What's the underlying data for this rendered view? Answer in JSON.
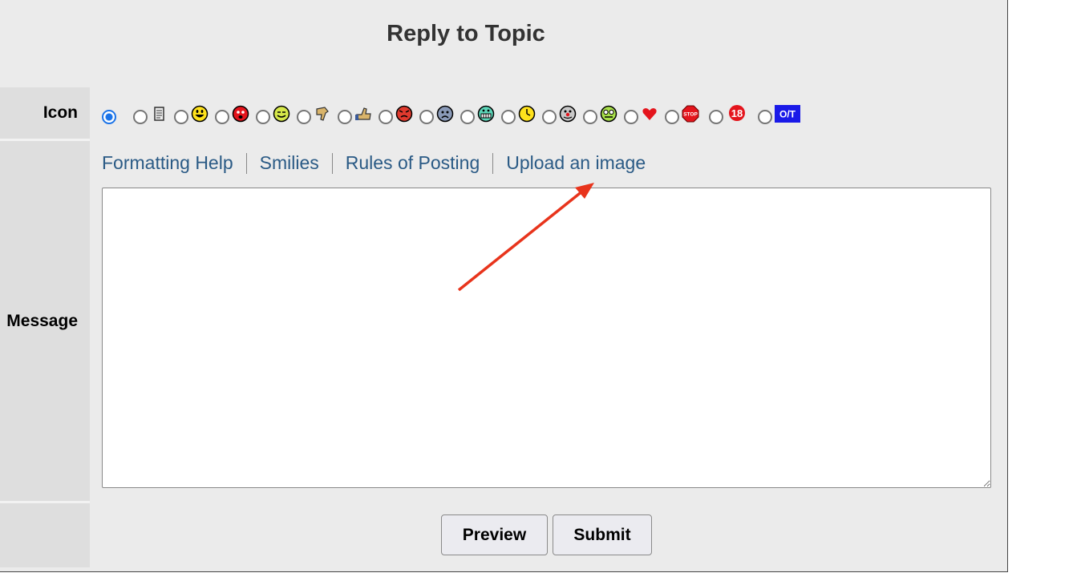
{
  "form": {
    "title": "Reply to Topic",
    "icon_label": "Icon",
    "message_label": "Message"
  },
  "icons": [
    {
      "name": "no-icon",
      "checked": true
    },
    {
      "name": "note-icon",
      "checked": false
    },
    {
      "name": "smile-icon",
      "checked": false
    },
    {
      "name": "angry-icon",
      "checked": false
    },
    {
      "name": "wink-icon",
      "checked": false
    },
    {
      "name": "thumbs-down-icon",
      "checked": false
    },
    {
      "name": "thumbs-up-icon",
      "checked": false
    },
    {
      "name": "mad-icon",
      "checked": false
    },
    {
      "name": "sad-icon",
      "checked": false
    },
    {
      "name": "grin-icon",
      "checked": false
    },
    {
      "name": "clock-icon",
      "checked": false
    },
    {
      "name": "clown-icon",
      "checked": false
    },
    {
      "name": "nerd-icon",
      "checked": false
    },
    {
      "name": "heart-icon",
      "checked": false
    },
    {
      "name": "stop-icon",
      "checked": false
    },
    {
      "name": "eighteen-icon",
      "checked": false
    },
    {
      "name": "off-topic-icon",
      "checked": false
    }
  ],
  "links": {
    "formatting_help": "Formatting Help",
    "smilies": "Smilies",
    "rules_of_posting": "Rules of Posting",
    "upload_image": "Upload an image"
  },
  "message": {
    "value": ""
  },
  "buttons": {
    "preview": "Preview",
    "submit": "Submit"
  },
  "icon_text": {
    "stop": "STOP",
    "eighteen": "18",
    "off_topic": "O/T"
  },
  "colors": {
    "link": "#2a5a85",
    "arrow": "#e8341c",
    "radio_checked": "#1a73e8"
  }
}
